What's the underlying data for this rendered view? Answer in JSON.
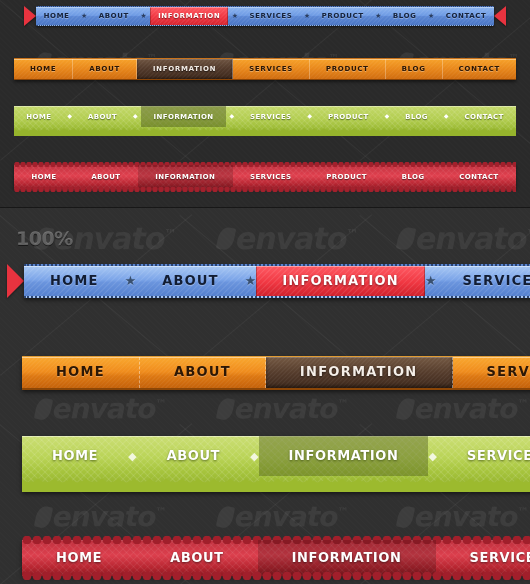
{
  "page": {
    "zoom_label": "100%",
    "background_color": "#2e2e2e",
    "watermark_text": "envato"
  },
  "icons": {
    "star": "★",
    "diamond": "◆",
    "ribbon_tail": "ribbon-tail"
  },
  "bars": {
    "blue_small": {
      "theme": "blue-ribbon",
      "accent_color": "#6d9ae4",
      "active_color": "#f03742",
      "separator_icon": "★",
      "items": [
        {
          "label": "HOME",
          "active": false
        },
        {
          "label": "ABOUT",
          "active": false
        },
        {
          "label": "INFORMATION",
          "active": true
        },
        {
          "label": "SERVICES",
          "active": false
        },
        {
          "label": "PRODUCT",
          "active": false
        },
        {
          "label": "BLOG",
          "active": false
        },
        {
          "label": "CONTACT",
          "active": false
        }
      ]
    },
    "orange_small": {
      "theme": "orange",
      "accent_color": "#e8871b",
      "active_color": "#51392a",
      "items": [
        {
          "label": "HOME",
          "active": false
        },
        {
          "label": "ABOUT",
          "active": false
        },
        {
          "label": "INFORMATION",
          "active": true
        },
        {
          "label": "SERVICES",
          "active": false
        },
        {
          "label": "PRODUCT",
          "active": false
        },
        {
          "label": "BLOG",
          "active": false
        },
        {
          "label": "CONTACT",
          "active": false
        }
      ]
    },
    "green_small": {
      "theme": "green-wave",
      "accent_color": "#b2cd4f",
      "active_color": "#6c7a2c",
      "separator_icon": "◆",
      "items": [
        {
          "label": "HOME",
          "active": false
        },
        {
          "label": "ABOUT",
          "active": false
        },
        {
          "label": "INFORMATION",
          "active": true
        },
        {
          "label": "SERVICES",
          "active": false
        },
        {
          "label": "PRODUCT",
          "active": false
        },
        {
          "label": "BLOG",
          "active": false
        },
        {
          "label": "CONTACT",
          "active": false
        }
      ]
    },
    "red_small": {
      "theme": "red-scallop",
      "accent_color": "#d03a47",
      "active_color": "#a82330",
      "items": [
        {
          "label": "HOME",
          "active": false
        },
        {
          "label": "ABOUT",
          "active": false
        },
        {
          "label": "INFORMATION",
          "active": true
        },
        {
          "label": "SERVICES",
          "active": false
        },
        {
          "label": "PRODUCT",
          "active": false
        },
        {
          "label": "BLOG",
          "active": false
        },
        {
          "label": "CONTACT",
          "active": false
        }
      ]
    },
    "blue_large": {
      "theme": "blue-ribbon",
      "accent_color": "#7ba4e8",
      "active_color": "#f03742",
      "separator_icon": "★",
      "items": [
        {
          "label": "HOME",
          "active": false
        },
        {
          "label": "ABOUT",
          "active": false
        },
        {
          "label": "INFORMATION",
          "active": true
        },
        {
          "label": "SERVICES",
          "active": false
        }
      ]
    },
    "orange_large": {
      "theme": "orange",
      "accent_color": "#ef8c1d",
      "active_color": "#553c2c",
      "items": [
        {
          "label": "HOME",
          "active": false
        },
        {
          "label": "ABOUT",
          "active": false
        },
        {
          "label": "INFORMATION",
          "active": true
        },
        {
          "label": "SERVICES",
          "active": false
        }
      ]
    },
    "green_large": {
      "theme": "green-wave",
      "accent_color": "#bad457",
      "active_color": "#6c7a2c",
      "separator_icon": "◆",
      "items": [
        {
          "label": "HOME",
          "active": false
        },
        {
          "label": "ABOUT",
          "active": false
        },
        {
          "label": "INFORMATION",
          "active": true
        },
        {
          "label": "SERVICES",
          "active": false
        }
      ]
    },
    "red_large": {
      "theme": "red-scallop",
      "accent_color": "#dc3f4d",
      "active_color": "#a82330",
      "items": [
        {
          "label": "HOME",
          "active": false
        },
        {
          "label": "ABOUT",
          "active": false
        },
        {
          "label": "INFORMATION",
          "active": true
        },
        {
          "label": "SERVICES",
          "active": false
        }
      ]
    }
  }
}
